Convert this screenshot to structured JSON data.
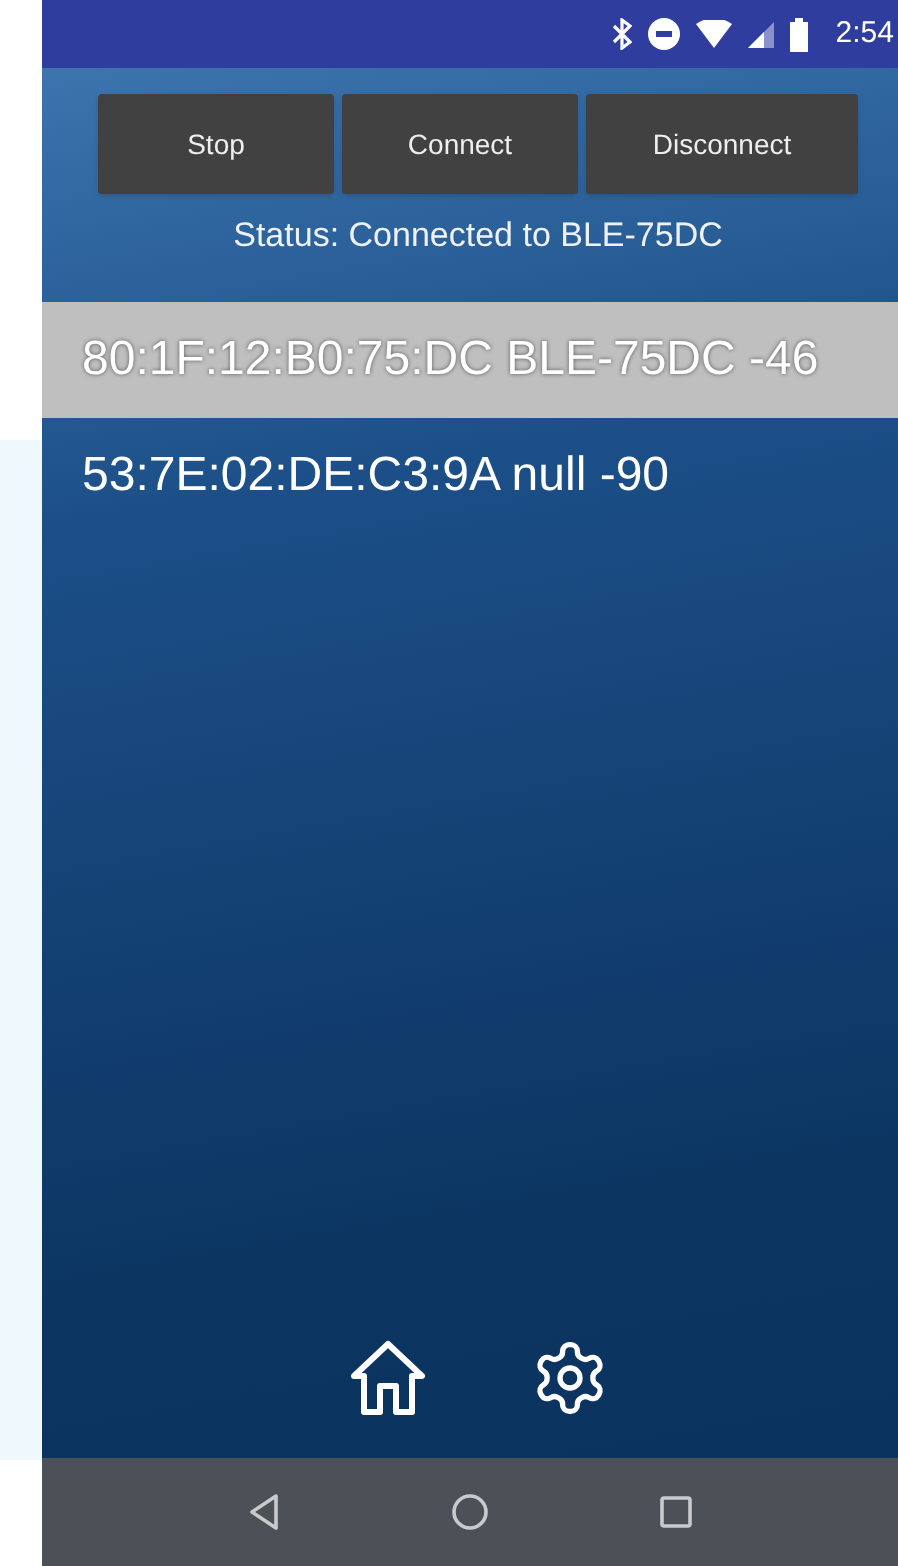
{
  "status_bar": {
    "time": "2:54"
  },
  "buttons": [
    {
      "label": "Stop"
    },
    {
      "label": "Connect"
    },
    {
      "label": "Disconnect"
    }
  ],
  "status": "Status: Connected to BLE-75DC",
  "devices": [
    {
      "text": "80:1F:12:B0:75:DC BLE-75DC -46",
      "selected": true
    },
    {
      "text": "53:7E:02:DE:C3:9A null -90",
      "selected": false
    }
  ]
}
